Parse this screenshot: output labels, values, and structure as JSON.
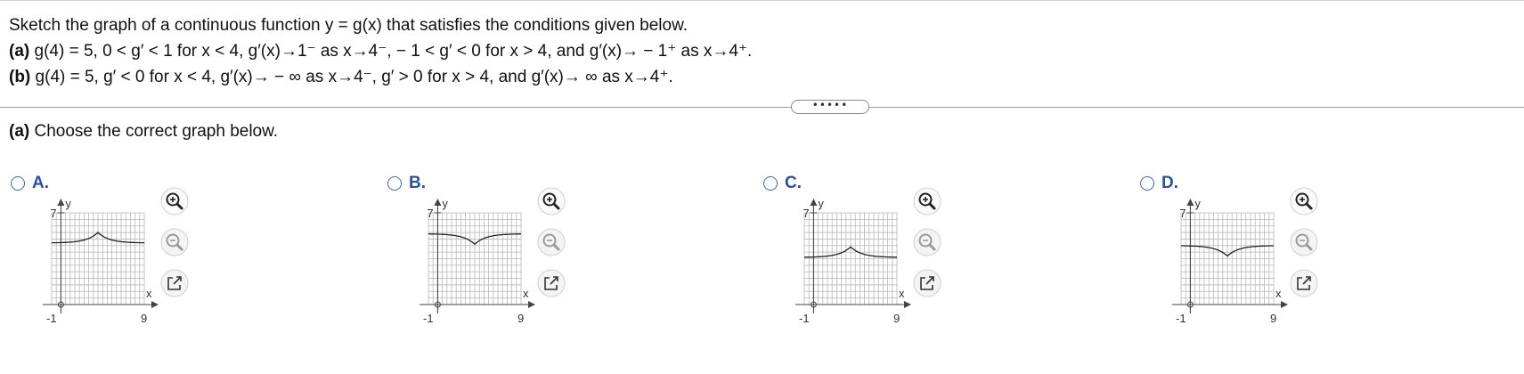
{
  "question": {
    "intro": "Sketch the graph of a continuous function y = g(x) that satisfies the conditions given below.",
    "part_a_label": "(a)",
    "part_a_text": " g(4) = 5, 0 < g′ < 1 for x < 4, g′(x)→1⁻ as x→4⁻, − 1 < g′ < 0 for x > 4, and g′(x)→ − 1⁺ as x→4⁺.",
    "part_b_label": "(b)",
    "part_b_text": " g(4) = 5, g′ < 0 for x < 4, g′(x)→ − ∞ as x→4⁻, g′ > 0 for x > 4, and g′(x)→ ∞ as x→4⁺."
  },
  "expander_label": "•••••",
  "part_heading_label": "(a)",
  "part_heading_text": " Choose the correct graph below.",
  "options": [
    {
      "letter": "A.",
      "shape": "peak",
      "base_y": 4.7,
      "peak_y": 5.5,
      "y_tick": "7",
      "x_min_label": "-1",
      "x_max_label": "9",
      "x_axis_label": "x",
      "y_axis_label": "y"
    },
    {
      "letter": "B.",
      "shape": "valley",
      "base_y": 5.4,
      "peak_y": 4.6,
      "y_tick": "7",
      "x_min_label": "-1",
      "x_max_label": "9",
      "x_axis_label": "x",
      "y_axis_label": "y"
    },
    {
      "letter": "C.",
      "shape": "peak",
      "base_y": 3.6,
      "peak_y": 4.4,
      "y_tick": "7",
      "x_min_label": "-1",
      "x_max_label": "9",
      "x_axis_label": "x",
      "y_axis_label": "y"
    },
    {
      "letter": "D.",
      "shape": "valley",
      "base_y": 4.5,
      "peak_y": 3.7,
      "y_tick": "7",
      "x_min_label": "-1",
      "x_max_label": "9",
      "x_axis_label": "x",
      "y_axis_label": "y"
    }
  ],
  "tools": {
    "zoom_in_icon": "zoom-in-icon",
    "zoom_out_icon": "zoom-out-icon",
    "popout_icon": "popout-icon"
  },
  "colors": {
    "radio_border": "#3c64b4",
    "option_letter": "#2d4fa0",
    "grid": "#b8b8b8",
    "curve": "#222222"
  }
}
